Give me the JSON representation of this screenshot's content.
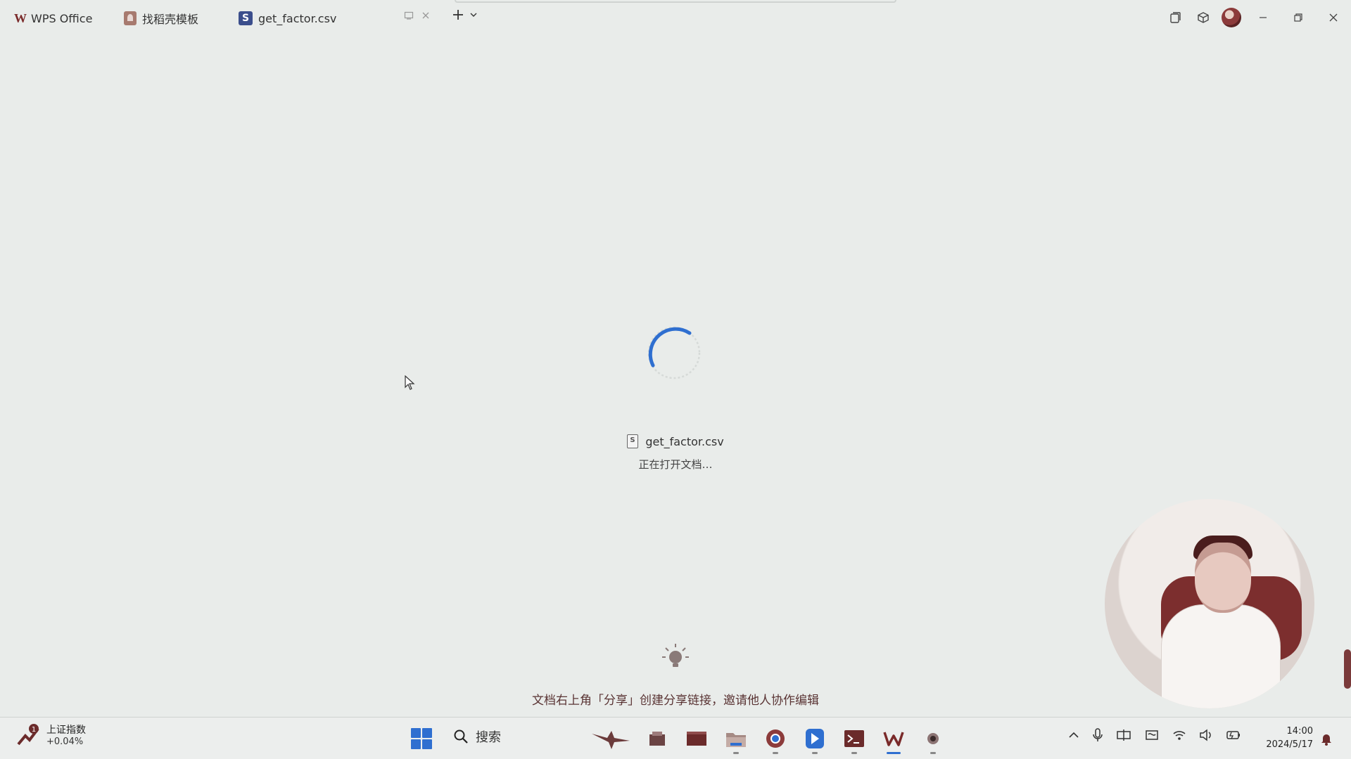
{
  "titlebar": {
    "tabs": [
      {
        "label": "WPS Office",
        "icon": "wps-logo-icon"
      },
      {
        "label": "找稻壳模板",
        "icon": "docer-template-icon"
      },
      {
        "label": "get_factor.csv",
        "icon": "spreadsheet-s-icon",
        "active": true
      }
    ],
    "wps_logo_glyph": "W",
    "sheet_glyph": "S"
  },
  "loading": {
    "file_name": "get_factor.csv",
    "status_text": "正在打开文档…",
    "tip_text": "文档右上角「分享」创建分享链接，邀请他人协作编辑"
  },
  "taskbar": {
    "widget_title": "上证指数",
    "widget_value": "+0.04%",
    "widget_badge": "1",
    "search_label": "搜索",
    "time": "14:00",
    "date": "2024/5/17"
  },
  "colors": {
    "background": "#e9ecea",
    "accent": "#2f6fd0",
    "spinner": "#2f6fd0"
  }
}
